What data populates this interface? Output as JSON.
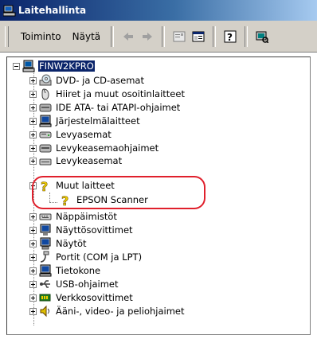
{
  "window": {
    "title": "Laitehallinta"
  },
  "toolbar": {
    "menu_action": "Toiminto",
    "menu_view": "Näytä",
    "buttons": [
      "back-icon",
      "forward-icon",
      "properties-icon",
      "tree-view-icon",
      "help-icon",
      "scan-icon"
    ]
  },
  "tree": {
    "root": "FINW2KPRO",
    "items": [
      {
        "label": "DVD- ja CD-asemat",
        "icon": "cdrom-icon"
      },
      {
        "label": "Hiiret ja muut osoitinlaitteet",
        "icon": "mouse-icon"
      },
      {
        "label": "IDE ATA- tai ATAPI-ohjaimet",
        "icon": "ide-controller-icon"
      },
      {
        "label": "Järjestelmälaitteet",
        "icon": "system-devices-icon"
      },
      {
        "label": "Levyasemat",
        "icon": "disk-drive-icon"
      },
      {
        "label": "Levykeasemaohjaimet",
        "icon": "floppy-controller-icon"
      },
      {
        "label": "Levykeasemat",
        "icon": "floppy-drive-icon"
      },
      {
        "label": "Muut laitteet",
        "icon": "unknown-device-icon",
        "expanded": true,
        "children": [
          {
            "label": "EPSON Scanner",
            "icon": "unknown-device-icon"
          }
        ]
      },
      {
        "label": "Näppäimistöt",
        "icon": "keyboard-icon"
      },
      {
        "label": "Näyttösovittimet",
        "icon": "display-adapter-icon"
      },
      {
        "label": "Näytöt",
        "icon": "monitor-icon"
      },
      {
        "label": "Portit (COM ja LPT)",
        "icon": "port-icon"
      },
      {
        "label": "Tietokone",
        "icon": "computer-icon"
      },
      {
        "label": "USB-ohjaimet",
        "icon": "usb-icon"
      },
      {
        "label": "Verkkosovittimet",
        "icon": "network-adapter-icon"
      },
      {
        "label": "Ääni-, video- ja peliohjaimet",
        "icon": "sound-icon"
      }
    ]
  },
  "colors": {
    "highlight_ring": "#e0202c",
    "titlebar": "#0a246a",
    "selection": "#0a246a"
  }
}
